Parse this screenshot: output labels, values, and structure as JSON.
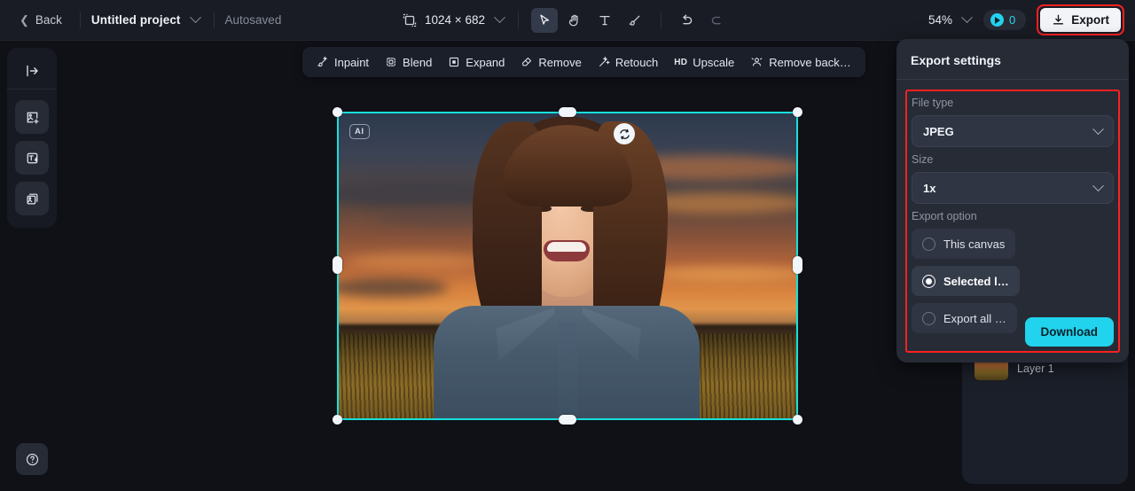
{
  "topbar": {
    "back_label": "Back",
    "project_name": "Untitled project",
    "autosave_status": "Autosaved",
    "canvas_dimensions": "1024 × 682",
    "canvas_size_icon": "artboard-icon",
    "tools": [
      {
        "name": "select-tool",
        "icon": "cursor-arrow-icon",
        "active": true
      },
      {
        "name": "hand-tool",
        "icon": "hand-icon",
        "active": false
      },
      {
        "name": "text-tool",
        "icon": "text-t-icon",
        "active": false
      },
      {
        "name": "brush-tool",
        "icon": "paintbrush-icon",
        "active": false
      },
      {
        "name": "undo",
        "icon": "undo-arrow-icon",
        "active": false
      },
      {
        "name": "redo",
        "icon": "redo-arrow-icon",
        "active": false
      }
    ],
    "zoom_level": "54%",
    "credits_count": "0",
    "credits_icon": "credit-coin-icon",
    "export_label": "Export",
    "export_icon": "download-icon"
  },
  "left_rail": {
    "collapse_icon": "panel-expand-icon",
    "items": [
      {
        "name": "add-image-tool",
        "icon": "image-plus-icon"
      },
      {
        "name": "text-to-image-tool",
        "icon": "text-to-image-icon"
      },
      {
        "name": "layers-tool",
        "icon": "stacked-images-icon"
      }
    ],
    "help_icon": "question-circle-icon"
  },
  "action_toolbar": {
    "items": [
      {
        "label": "Inpaint",
        "icon": "magic-brush-icon"
      },
      {
        "label": "Blend",
        "icon": "blend-icon"
      },
      {
        "label": "Expand",
        "icon": "expand-icon"
      },
      {
        "label": "Remove",
        "icon": "eraser-icon"
      },
      {
        "label": "Retouch",
        "icon": "magic-wand-icon"
      },
      {
        "label": "Upscale",
        "icon": "hd-icon",
        "badge": "HD"
      },
      {
        "label": "Remove back…",
        "icon": "remove-background-icon"
      }
    ]
  },
  "canvas": {
    "ai_badge": "AI",
    "regenerate_icon": "refresh-icon",
    "selection_color": "#18e0dc",
    "image_description": "Smiling woman in a denim shirt against a sunset prairie field"
  },
  "right_panel": {
    "layer_name": "Layer 1"
  },
  "export_settings": {
    "title": "Export settings",
    "file_type_label": "File type",
    "file_type_value": "JPEG",
    "size_label": "Size",
    "size_value": "1x",
    "export_option_label": "Export option",
    "options": [
      {
        "label": "This canvas",
        "selected": false
      },
      {
        "label": "Selected l…",
        "selected": true
      },
      {
        "label": "Export all …",
        "selected": false
      }
    ],
    "download_label": "Download",
    "accent_color": "#22d3ee",
    "highlight_color": "#ff2020"
  }
}
